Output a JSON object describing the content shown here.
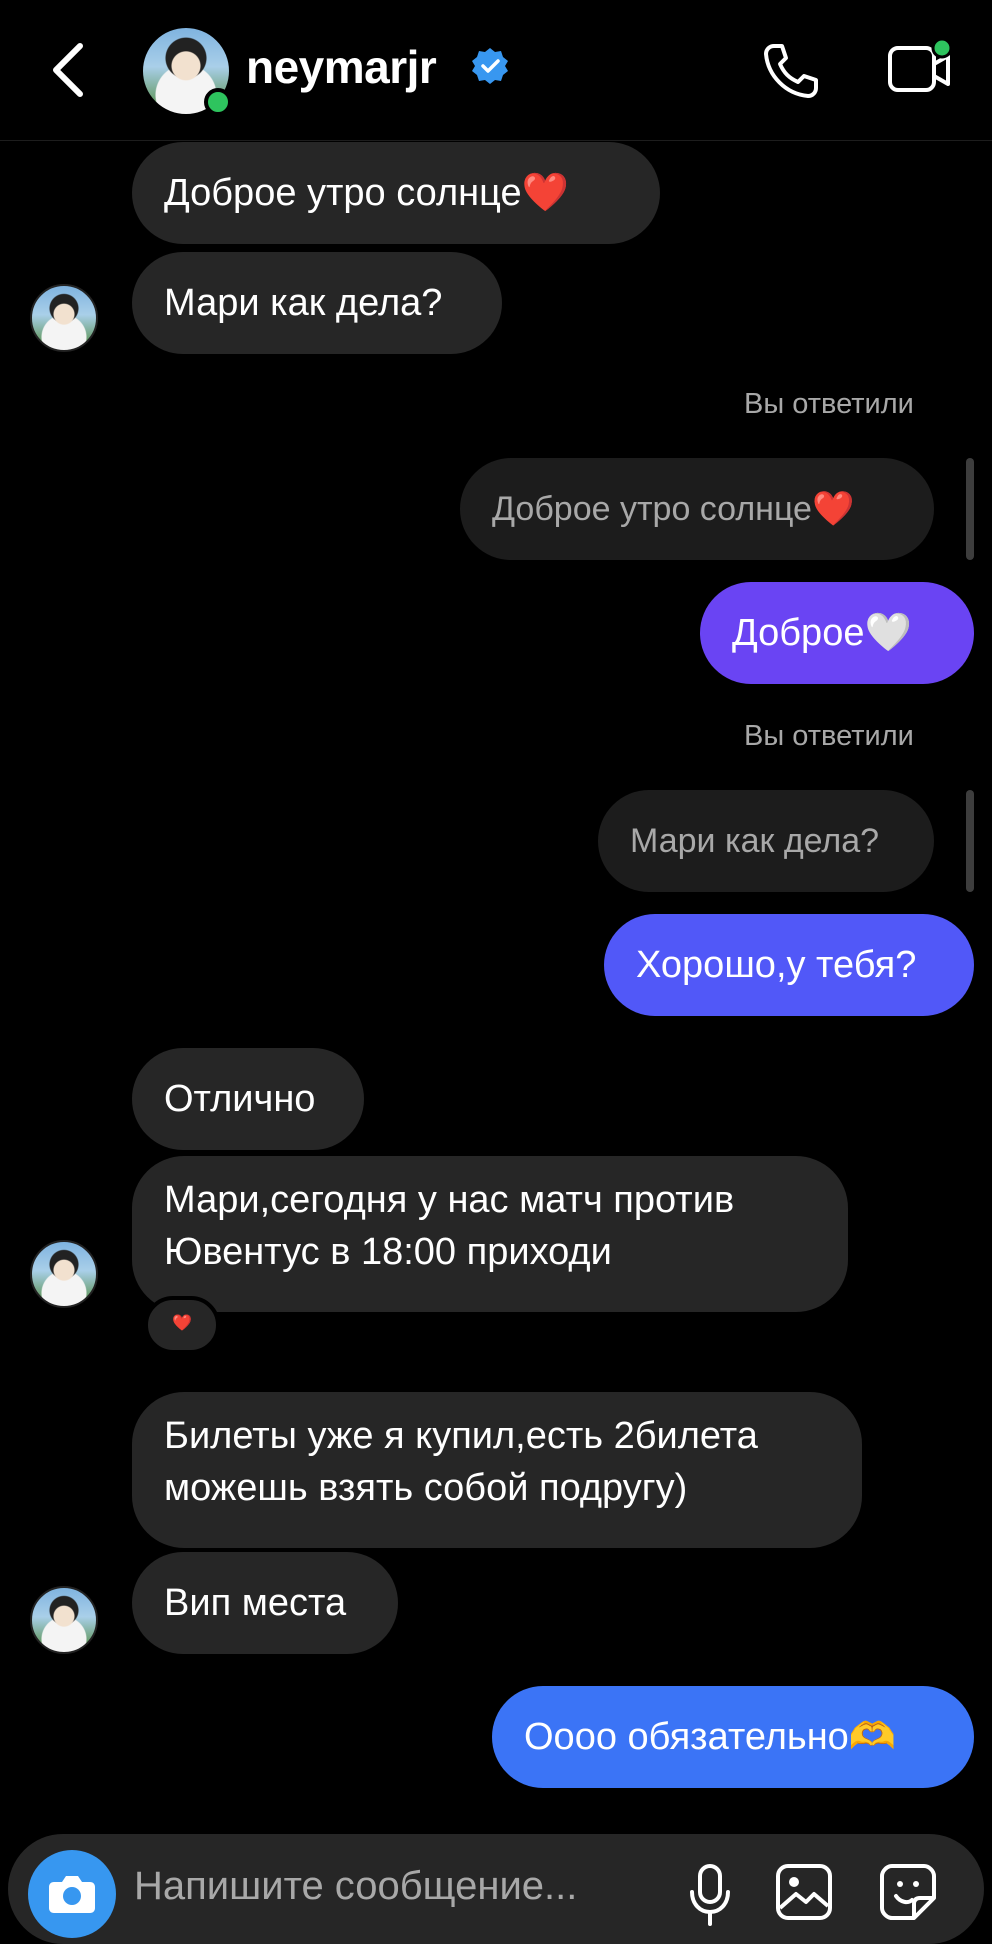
{
  "header": {
    "username": "neymarjr",
    "back_icon": "chevron-left-icon",
    "verified_icon": "verified-badge-icon",
    "call_icon": "phone-icon",
    "video_icon": "video-call-icon",
    "online_color": "#2ec45e",
    "verified_color": "#3897f0"
  },
  "messages": [
    {
      "side": "in",
      "text": "Доброе утро солнце❤️"
    },
    {
      "side": "in",
      "text": "Мари как дела?"
    },
    {
      "side": "label",
      "text": "Вы ответили"
    },
    {
      "side": "reply-preview",
      "text": "Доброе утро солнце❤️"
    },
    {
      "side": "out",
      "text": "Доброе🤍"
    },
    {
      "side": "label",
      "text": "Вы ответили"
    },
    {
      "side": "reply-preview",
      "text": "Мари как дела?"
    },
    {
      "side": "out",
      "text": "Хорошо,у тебя?"
    },
    {
      "side": "in",
      "text": "Отлично"
    },
    {
      "side": "in",
      "text": "Мари,сегодня у нас матч против Ювентус в 18:00 приходи",
      "reaction": "❤️"
    },
    {
      "side": "in",
      "text": "Билеты уже я купил,есть 2билета можешь взять собой подругу)"
    },
    {
      "side": "in",
      "text": "Вип места"
    },
    {
      "side": "out",
      "text": "Оооо обязательно🫶"
    }
  ],
  "composer": {
    "placeholder": "Напишите сообщение...",
    "camera_icon": "camera-icon",
    "mic_icon": "microphone-icon",
    "gallery_icon": "image-gallery-icon",
    "sticker_icon": "sticker-icon",
    "camera_color": "#3797f0"
  },
  "colors": {
    "incoming_bubble": "#262626",
    "outgoing_purple": "#6a44f3",
    "outgoing_indigo": "#5158f8",
    "outgoing_blue": "#3b74f6"
  }
}
